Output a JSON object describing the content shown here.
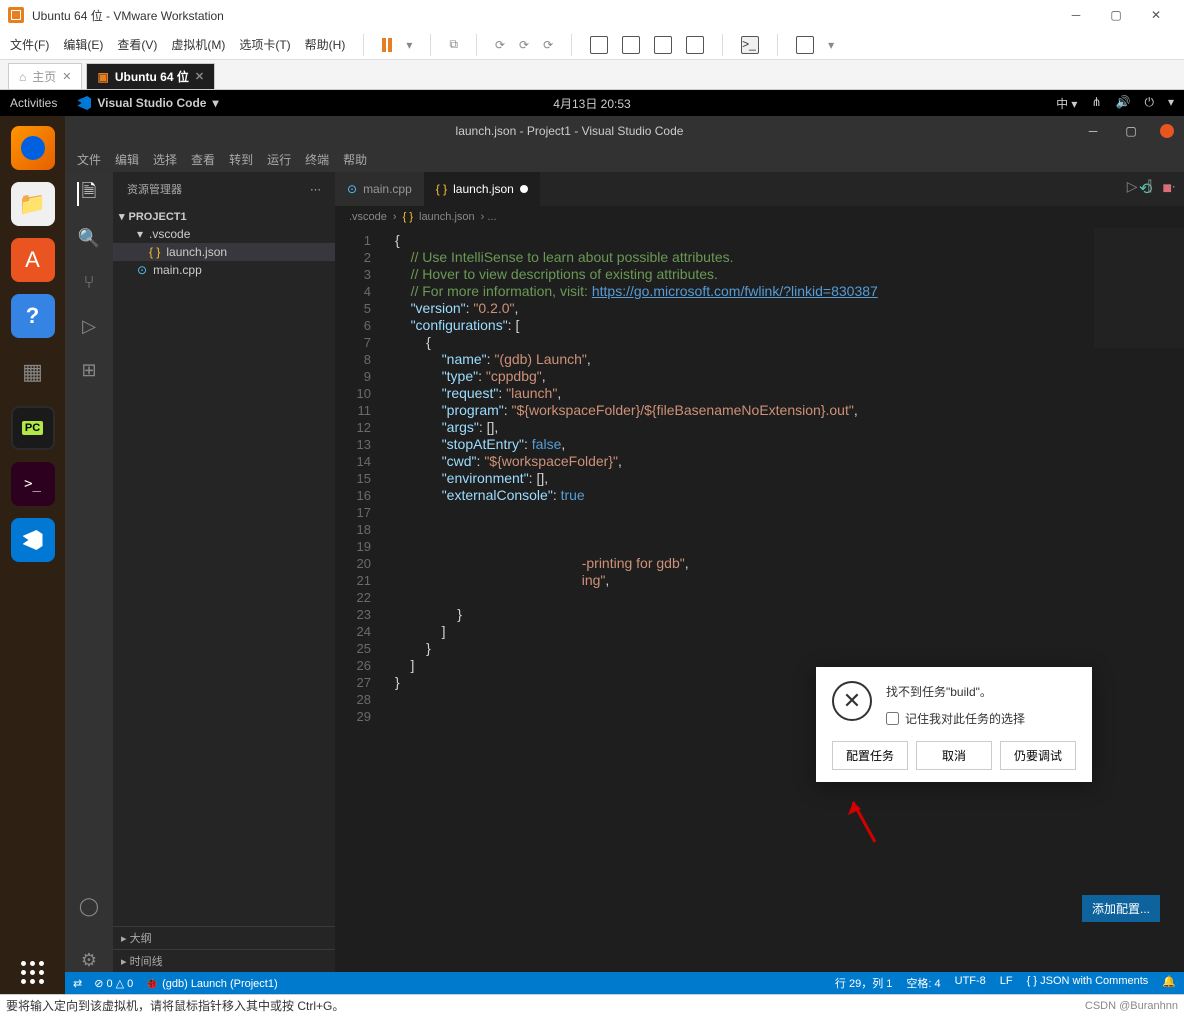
{
  "vmware": {
    "title": "Ubuntu 64 位 - VMware Workstation",
    "menus": [
      "文件(F)",
      "编辑(E)",
      "查看(V)",
      "虚拟机(M)",
      "选项卡(T)",
      "帮助(H)"
    ],
    "tabs": {
      "home": "主页",
      "active": "Ubuntu 64 位"
    }
  },
  "ubuntu": {
    "activities": "Activities",
    "app": "Visual Studio Code",
    "clock": "4月13日  20:53",
    "lang": "中"
  },
  "vscode": {
    "title": "launch.json - Project1 - Visual Studio Code",
    "menus": [
      "文件",
      "编辑",
      "选择",
      "查看",
      "转到",
      "运行",
      "终端",
      "帮助"
    ],
    "explorer": {
      "label": "资源管理器",
      "project": "PROJECT1",
      "vscode_folder": ".vscode",
      "files": {
        "launch": "launch.json",
        "main": "main.cpp"
      },
      "outline": "大纲",
      "timeline": "时间线"
    },
    "tabs": {
      "main": "main.cpp",
      "launch": "launch.json"
    },
    "breadcrumb": {
      "folder": ".vscode",
      "file": "launch.json"
    },
    "add_config": "添加配置...",
    "status": {
      "errors": "⊘ 0 △ 0",
      "debug": "(gdb) Launch (Project1)",
      "pos": "行 29，列 1",
      "spaces": "空格: 4",
      "enc": "UTF-8",
      "eol": "LF",
      "lang": "{ } JSON with Comments"
    },
    "code": {
      "c1": "// Use IntelliSense to learn about possible attributes.",
      "c2": "// Hover to view descriptions of existing attributes.",
      "c3": "// For more information, visit: ",
      "link": "https://go.microsoft.com/fwlink/?linkid=830387",
      "version_k": "\"version\"",
      "version_v": "\"0.2.0\"",
      "conf_k": "\"configurations\"",
      "name_k": "\"name\"",
      "name_v": "\"(gdb) Launch\"",
      "type_k": "\"type\"",
      "type_v": "\"cppdbg\"",
      "request_k": "\"request\"",
      "request_v": "\"launch\"",
      "program_k": "\"program\"",
      "program_v": "\"${workspaceFolder}/${fileBasenameNoExtension}.out\"",
      "args_k": "\"args\"",
      "stop_k": "\"stopAtEntry\"",
      "stop_v": "false",
      "cwd_k": "\"cwd\"",
      "cwd_v": "\"${workspaceFolder}\"",
      "env_k": "\"environment\"",
      "ext_k": "\"externalConsole\"",
      "ext_v": "true",
      "frag1": "-printing for gdb\"",
      "frag2": "ing\""
    }
  },
  "dialog": {
    "message": "找不到任务\"build\"。",
    "checkbox": "记住我对此任务的选择",
    "btn_config": "配置任务",
    "btn_cancel": "取消",
    "btn_debug": "仍要调试"
  },
  "hint": "要将输入定向到该虚拟机，请将鼠标指针移入其中或按 Ctrl+G。",
  "watermark": "CSDN @Buranhnn"
}
